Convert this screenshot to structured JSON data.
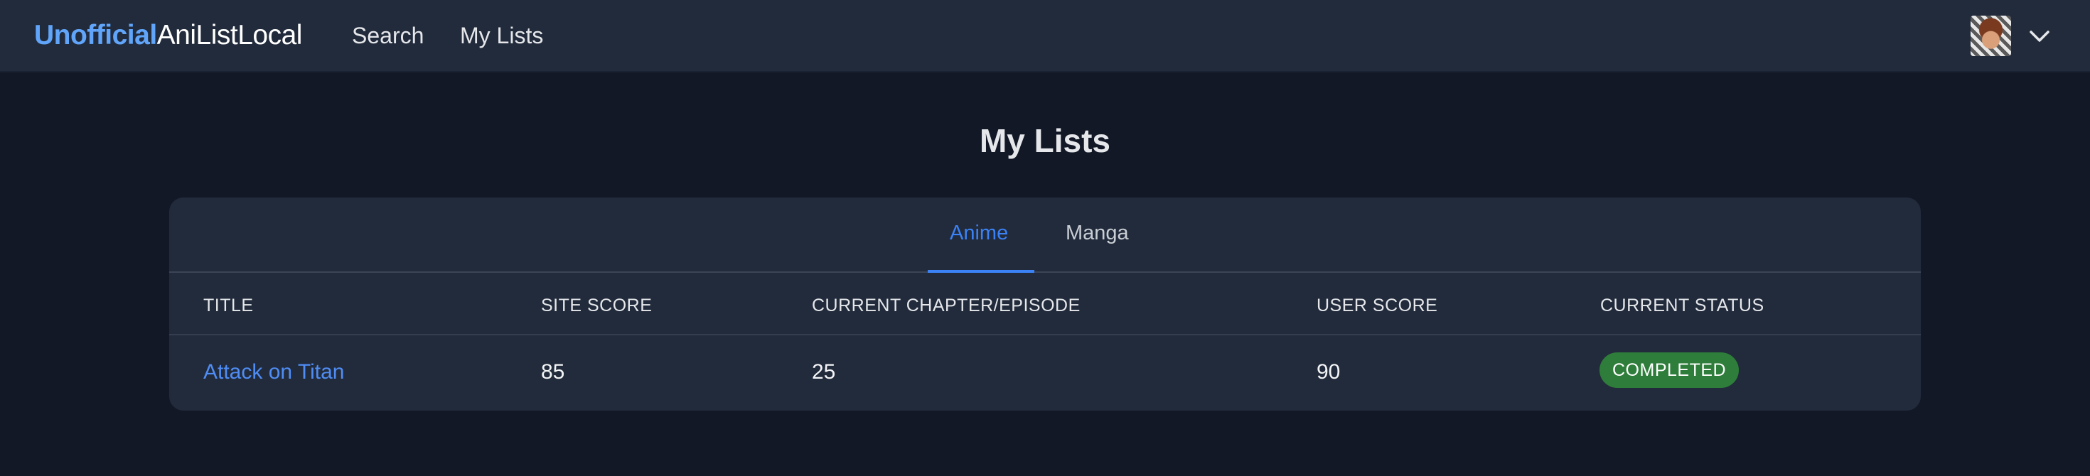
{
  "navbar": {
    "brand_accent": "Unofficial",
    "brand_rest": "AniListLocal",
    "links": [
      "Search",
      "My Lists"
    ],
    "avatar_icon": "user-avatar",
    "menu_icon": "chevron-down-icon"
  },
  "page": {
    "title": "My Lists"
  },
  "tabs": {
    "items": [
      "Anime",
      "Manga"
    ],
    "active": "Anime"
  },
  "table": {
    "headers": [
      "TITLE",
      "SITE SCORE",
      "CURRENT CHAPTER/EPISODE",
      "USER SCORE",
      "CURRENT STATUS"
    ],
    "rows": [
      {
        "title": "Attack on Titan",
        "site_score": "85",
        "current_progress": "25",
        "user_score": "90",
        "status": "COMPLETED"
      }
    ]
  },
  "colors": {
    "accent": "#60a5fa",
    "tab_active": "#3b82f6",
    "status_completed": "#2e7d3a",
    "background": "#121826",
    "surface": "#222b3b"
  }
}
